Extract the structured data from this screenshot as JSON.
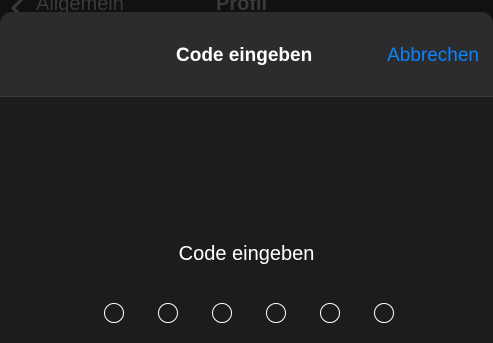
{
  "behind_nav": {
    "back_label": "Allgemein",
    "title": "Profil"
  },
  "sheet": {
    "title": "Code eingeben",
    "cancel_label": "Abbrechen"
  },
  "passcode": {
    "prompt": "Code eingeben",
    "length": 6,
    "entered": 0
  },
  "colors": {
    "accent": "#0a84ff",
    "sheet_background": "#1c1c1e",
    "header_background": "#2c2c2e",
    "text": "#ffffff"
  }
}
